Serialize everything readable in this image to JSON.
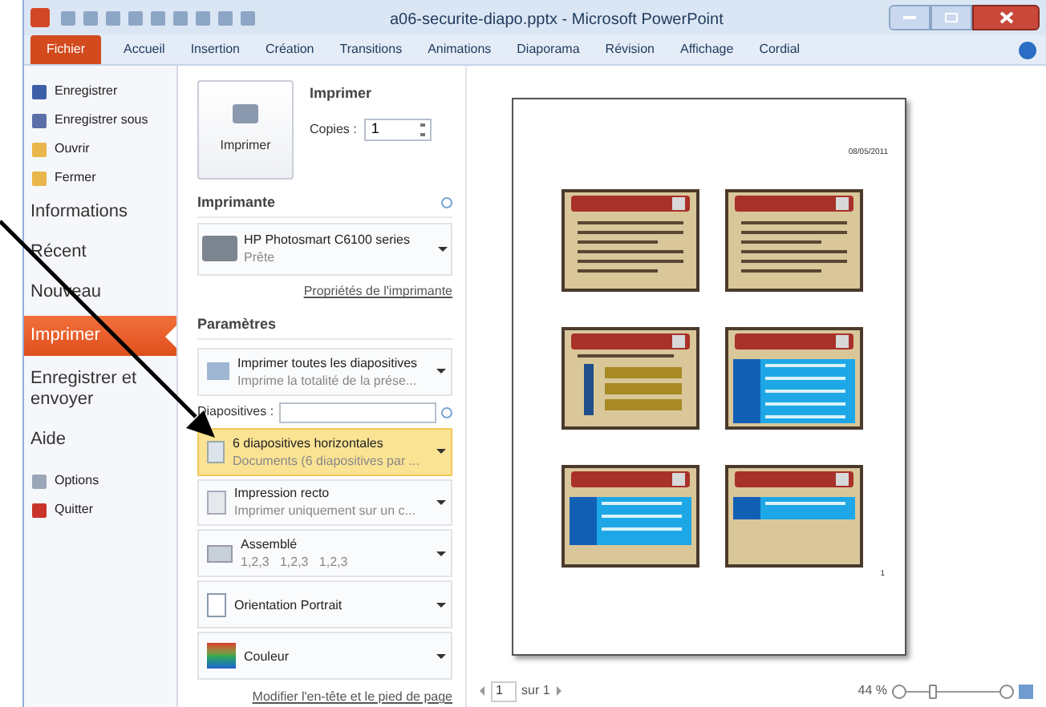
{
  "window": {
    "title": "a06-securite-diapo.pptx - Microsoft PowerPoint"
  },
  "ribbon_tabs": [
    {
      "label": "Fichier",
      "selected": true
    },
    {
      "label": "Accueil",
      "selected": false
    },
    {
      "label": "Insertion",
      "selected": false
    },
    {
      "label": "Création",
      "selected": false
    },
    {
      "label": "Transitions",
      "selected": false
    },
    {
      "label": "Animations",
      "selected": false
    },
    {
      "label": "Diaporama",
      "selected": false
    },
    {
      "label": "Révision",
      "selected": false
    },
    {
      "label": "Affichage",
      "selected": false
    },
    {
      "label": "Cordial",
      "selected": false
    }
  ],
  "nav": [
    {
      "kind": "save",
      "label": "Enregistrer"
    },
    {
      "kind": "saveas",
      "label": "Enregistrer sous"
    },
    {
      "kind": "open",
      "label": "Ouvrir"
    },
    {
      "kind": "close",
      "label": "Fermer"
    },
    {
      "kind": "page",
      "label": "Informations",
      "selected": false
    },
    {
      "kind": "page",
      "label": "Récent",
      "selected": false
    },
    {
      "kind": "page",
      "label": "Nouveau",
      "selected": false
    },
    {
      "kind": "page",
      "label": "Imprimer",
      "selected": true
    },
    {
      "kind": "page",
      "label": "Enregistrer et envoyer",
      "selected": false
    },
    {
      "kind": "page",
      "label": "Aide",
      "selected": false
    },
    {
      "kind": "options",
      "label": "Options"
    },
    {
      "kind": "quit",
      "label": "Quitter"
    }
  ],
  "print": {
    "button": "Imprimer",
    "heading": "Imprimer",
    "copies_label": "Copies :",
    "copies": "1"
  },
  "printer": {
    "heading": "Imprimante",
    "name": "HP Photosmart C6100 series",
    "status": "Prête",
    "properties_link": "Propriétés de l'imprimante"
  },
  "settings": {
    "heading": "Paramètres",
    "slides_label": "Diapositives :",
    "options": [
      {
        "kind": "slides",
        "title": "Imprimer toutes les diapositives",
        "subtitle": "Imprime la totalité de la prése...",
        "selected": false
      },
      {
        "kind": "layout",
        "title": "6 diapositives horizontales",
        "subtitle": "Documents (6 diapositives par ...",
        "selected": true
      },
      {
        "kind": "sides",
        "title": "Impression recto",
        "subtitle": "Imprimer uniquement sur un c...",
        "selected": false
      },
      {
        "kind": "collate",
        "title": "Assemblé",
        "subtitle": "1,2,3   1,2,3   1,2,3",
        "selected": false
      },
      {
        "kind": "orientation",
        "title": "Orientation Portrait",
        "selected": false
      },
      {
        "kind": "color",
        "title": "Couleur",
        "selected": false
      }
    ],
    "header_footer_link": "Modifier l'en-tête et le pied de page"
  },
  "preview": {
    "date": "08/05/2011",
    "page_number": "1",
    "slides": [
      {
        "kind": "text"
      },
      {
        "kind": "text"
      },
      {
        "kind": "diagram"
      },
      {
        "kind": "table"
      },
      {
        "kind": "table"
      },
      {
        "kind": "table"
      }
    ]
  },
  "status_bar": {
    "page": "1",
    "page_total": "sur 1",
    "zoom": "44 %",
    "zoom_slider": {
      "level": 0.27
    }
  }
}
